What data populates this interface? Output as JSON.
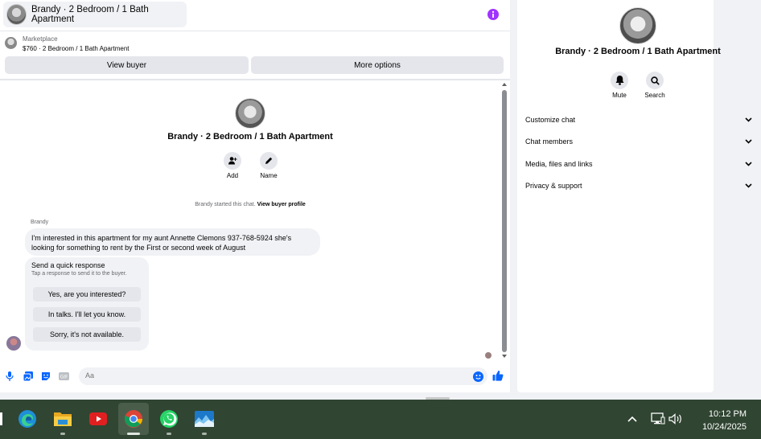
{
  "chat": {
    "title": "Brandy · 2 Bedroom / 1 Bath Apartment",
    "marketplace_label": "Marketplace",
    "listing": "$760 · 2 Bedroom / 1 Bath Apartment",
    "view_buyer": "View buyer",
    "more_options": "More options",
    "center_name": "Brandy · 2 Bedroom / 1 Bath Apartment",
    "add_label": "Add",
    "name_label": "Name",
    "started_text": "Brandy started this chat.",
    "view_buyer_profile": "View buyer profile",
    "sender": "Brandy",
    "message": "I'm interested in this apartment for my aunt Annette Clemons 937-768-5924 she's looking for something to rent by the First or second week of August",
    "quick_title": "Send a quick response",
    "quick_sub": "Tap a response to send it to the buyer.",
    "quick_replies": [
      "Yes, are you interested?",
      "In talks. I'll let you know.",
      "Sorry, it's not available."
    ],
    "composer_placeholder": "Aa"
  },
  "info_panel": {
    "name": "Brandy · 2 Bedroom / 1 Bath Apartment",
    "mute": "Mute",
    "search": "Search",
    "rows": [
      "Customize chat",
      "Chat members",
      "Media, files and links",
      "Privacy & support"
    ]
  },
  "taskbar": {
    "time": "10:12 PM",
    "date": "10/24/2025"
  },
  "colors": {
    "accent": "#0866ff",
    "info_purple": "#a033ff",
    "taskbar": "#304532"
  }
}
